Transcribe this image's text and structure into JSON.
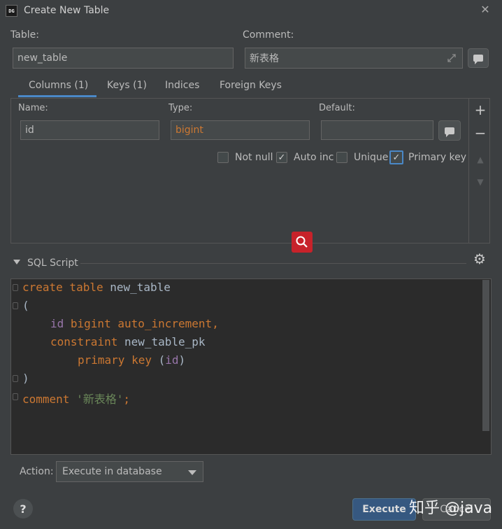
{
  "window": {
    "title": "Create New Table",
    "app_icon_text": "DG"
  },
  "table": {
    "label": "Table:",
    "value": "new_table"
  },
  "comment": {
    "label": "Comment:",
    "value": "新表格"
  },
  "tabs": [
    {
      "label": "Columns (1)",
      "active": true
    },
    {
      "label": "Keys (1)",
      "active": false
    },
    {
      "label": "Indices",
      "active": false
    },
    {
      "label": "Foreign Keys",
      "active": false
    }
  ],
  "column": {
    "name_label": "Name:",
    "name_value": "id",
    "type_label": "Type:",
    "type_value": "bigint",
    "default_label": "Default:",
    "default_value": ""
  },
  "checkboxes": [
    {
      "label": "Not null",
      "checked": false
    },
    {
      "label": "Auto inc",
      "checked": true
    },
    {
      "label": "Unique",
      "checked": false
    },
    {
      "label": "Primary key",
      "checked": true
    }
  ],
  "sql": {
    "section_label": "SQL Script",
    "lines": {
      "l1_kw": "create table",
      "l1_name": " new_table",
      "l2": "(",
      "l3_col": "id",
      "l3_kw": " bigint auto_increment,",
      "l4_kw": "constraint",
      "l4_name": " new_table_pk",
      "l5_kw": "primary key",
      "l5_open": " (",
      "l5_col": "id",
      "l5_close": ")",
      "l6": ")",
      "l7_kw": "comment",
      "l7_str": " '新表格'",
      "l7_end": ";"
    }
  },
  "action": {
    "label": "Action:",
    "value": "Execute in database"
  },
  "buttons": {
    "execute": "Execute",
    "cancel": "Cancel",
    "help": "?"
  },
  "watermark": "知乎 @java",
  "colors": {
    "accent": "#4a88c7",
    "keyword": "#cc7832",
    "string": "#6a8759",
    "column": "#9876aa",
    "search_red": "#c7222a"
  }
}
